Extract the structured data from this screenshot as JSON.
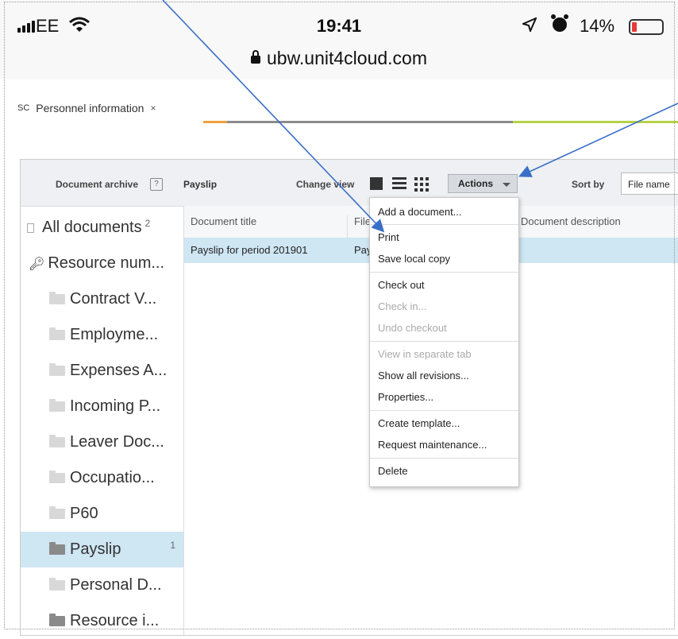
{
  "status_bar": {
    "carrier": "EE",
    "time": "19:41",
    "battery": "14%",
    "battery_level": 0.14,
    "url": "ubw.unit4cloud.com",
    "icons": [
      "signal-icon",
      "wifi-icon",
      "location-icon",
      "alarm-icon",
      "battery-icon",
      "lock-icon"
    ]
  },
  "tab": {
    "tag": "SC",
    "label": "Personnel information",
    "close": "×"
  },
  "toolbar": {
    "archive_label": "Document archive",
    "help": "?",
    "folder": "Payslip",
    "change_view_label": "Change view",
    "actions_label": "Actions",
    "sort_label": "Sort by",
    "sort_value": "File name"
  },
  "tree": [
    {
      "label": "All documents",
      "count": "2",
      "icon": "document-icon"
    },
    {
      "label": "Resource num...",
      "icon": "key-icon"
    },
    {
      "label": "Contract V...",
      "icon": "folder-icon"
    },
    {
      "label": "Employme...",
      "icon": "folder-icon"
    },
    {
      "label": "Expenses A...",
      "icon": "folder-icon"
    },
    {
      "label": "Incoming P...",
      "icon": "folder-icon"
    },
    {
      "label": "Leaver Doc...",
      "icon": "folder-icon"
    },
    {
      "label": "Occupatio...",
      "icon": "folder-icon"
    },
    {
      "label": "P60",
      "icon": "folder-icon"
    },
    {
      "label": "Payslip",
      "count": "1",
      "icon": "folder-icon"
    },
    {
      "label": "Personal D...",
      "icon": "folder-icon"
    },
    {
      "label": "Resource i...",
      "icon": "folder-icon"
    }
  ],
  "grid": {
    "columns": [
      "Document title",
      "File",
      "Document description"
    ],
    "rows": [
      {
        "title": "Payslip for period 201901",
        "file": "Pay"
      }
    ]
  },
  "menu": [
    {
      "label": "Add a document...",
      "disabled": false
    },
    {
      "label": "Print",
      "disabled": false
    },
    {
      "label": "Save local copy",
      "disabled": false
    },
    {
      "label": "Check out",
      "disabled": false
    },
    {
      "label": "Check in...",
      "disabled": true
    },
    {
      "label": "Undo checkout",
      "disabled": true
    },
    {
      "label": "View in separate tab",
      "disabled": true
    },
    {
      "label": "Show all revisions...",
      "disabled": false
    },
    {
      "label": "Properties...",
      "disabled": false
    },
    {
      "label": "Create template...",
      "disabled": false
    },
    {
      "label": "Request maintenance...",
      "disabled": false
    },
    {
      "label": "Delete",
      "disabled": false
    }
  ],
  "colors": {
    "selection": "#cfe6f3",
    "arrow": "#3a6fc8",
    "tab_line_orange": "#f0a040",
    "tab_line_gray": "#8c8c8c",
    "tab_line_green": "#b8d24a"
  }
}
